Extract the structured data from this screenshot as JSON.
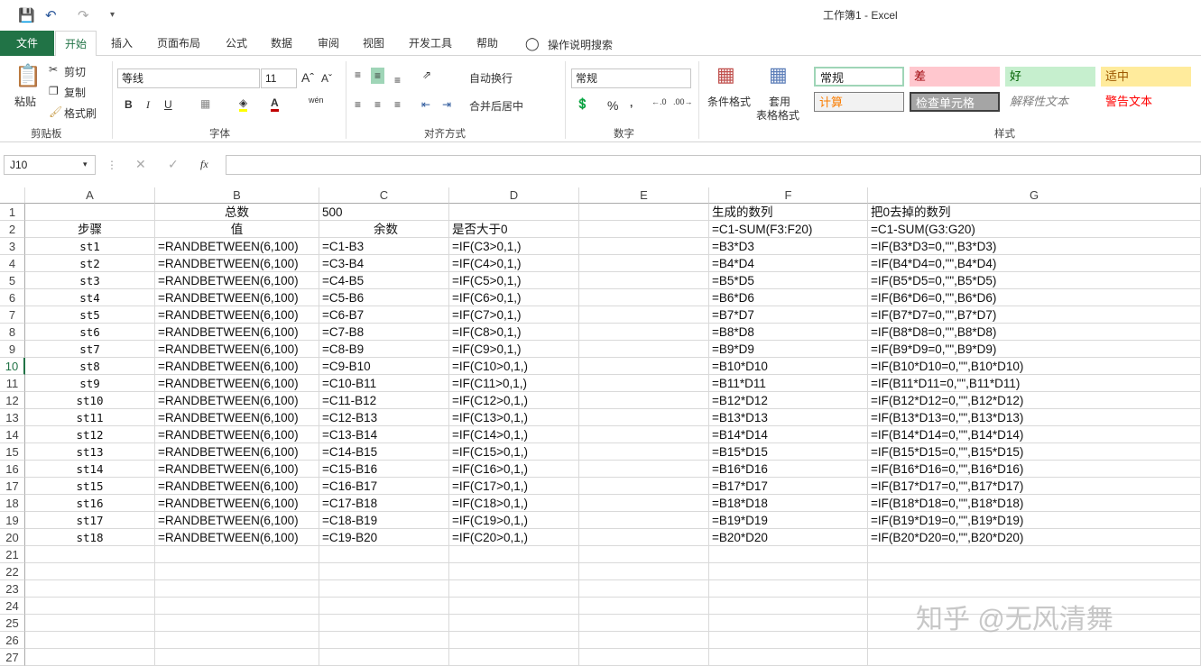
{
  "window": {
    "title": "工作簿1  -  Excel"
  },
  "tabs": [
    "文件",
    "开始",
    "插入",
    "页面布局",
    "公式",
    "数据",
    "审阅",
    "视图",
    "开发工具",
    "帮助"
  ],
  "search_label": "操作说明搜索",
  "clipboard": {
    "paste": "粘贴",
    "cut": "剪切",
    "copy": "复制",
    "format_painter": "格式刷",
    "label": "剪贴板"
  },
  "font": {
    "name": "等线",
    "size": "11",
    "label": "字体",
    "bold": "B",
    "italic": "I",
    "underline": "U",
    "phonetic": "wén"
  },
  "align": {
    "wrap": "自动换行",
    "merge": "合并后居中",
    "label": "对齐方式"
  },
  "number": {
    "format": "常规",
    "percent": "%",
    "comma": ",",
    "label": "数字"
  },
  "styles": {
    "cond": "条件格式",
    "table1": "套用",
    "table2": "表格格式",
    "label": "样式",
    "cells": [
      {
        "t": "常规",
        "bg": "#ffffff",
        "fg": "#222"
      },
      {
        "t": "差",
        "bg": "#ffc7ce",
        "fg": "#9c0006"
      },
      {
        "t": "好",
        "bg": "#c6efce",
        "fg": "#006100"
      },
      {
        "t": "适中",
        "bg": "#ffeb9c",
        "fg": "#9c5700"
      },
      {
        "t": "计算",
        "bg": "#f2f2f2",
        "fg": "#fa7d00"
      },
      {
        "t": "检查单元格",
        "bg": "#a5a5a5",
        "fg": "#ffffff"
      },
      {
        "t": "解释性文本",
        "bg": "#ffffff",
        "fg": "#7f7f7f"
      },
      {
        "t": "警告文本",
        "bg": "#ffffff",
        "fg": "#ff0000"
      }
    ]
  },
  "formula_bar": {
    "name_box": "J10",
    "fx": "fx",
    "value": ""
  },
  "columns": [
    "A",
    "B",
    "C",
    "D",
    "E",
    "F",
    "G"
  ],
  "row_numbers": [
    "1",
    "2",
    "3",
    "4",
    "5",
    "6",
    "7",
    "8",
    "9",
    "10",
    "11",
    "12",
    "13",
    "14",
    "15",
    "16",
    "17",
    "18",
    "19",
    "20",
    "21",
    "22",
    "23",
    "24",
    "25",
    "26",
    "27"
  ],
  "rows": [
    [
      "",
      "总数",
      "500",
      "",
      "",
      "生成的数列",
      "把0去掉的数列"
    ],
    [
      "步骤",
      "值",
      "余数",
      "是否大于0",
      "",
      "=C1-SUM(F3:F20)",
      "=C1-SUM(G3:G20)"
    ],
    [
      "st1",
      "=RANDBETWEEN(6,100)",
      "=C1-B3",
      "=IF(C3>0,1,)",
      "",
      "=B3*D3",
      "=IF(B3*D3=0,\"\",B3*D3)"
    ],
    [
      "st2",
      "=RANDBETWEEN(6,100)",
      "=C3-B4",
      "=IF(C4>0,1,)",
      "",
      "=B4*D4",
      "=IF(B4*D4=0,\"\",B4*D4)"
    ],
    [
      "st3",
      "=RANDBETWEEN(6,100)",
      "=C4-B5",
      "=IF(C5>0,1,)",
      "",
      "=B5*D5",
      "=IF(B5*D5=0,\"\",B5*D5)"
    ],
    [
      "st4",
      "=RANDBETWEEN(6,100)",
      "=C5-B6",
      "=IF(C6>0,1,)",
      "",
      "=B6*D6",
      "=IF(B6*D6=0,\"\",B6*D6)"
    ],
    [
      "st5",
      "=RANDBETWEEN(6,100)",
      "=C6-B7",
      "=IF(C7>0,1,)",
      "",
      "=B7*D7",
      "=IF(B7*D7=0,\"\",B7*D7)"
    ],
    [
      "st6",
      "=RANDBETWEEN(6,100)",
      "=C7-B8",
      "=IF(C8>0,1,)",
      "",
      "=B8*D8",
      "=IF(B8*D8=0,\"\",B8*D8)"
    ],
    [
      "st7",
      "=RANDBETWEEN(6,100)",
      "=C8-B9",
      "=IF(C9>0,1,)",
      "",
      "=B9*D9",
      "=IF(B9*D9=0,\"\",B9*D9)"
    ],
    [
      "st8",
      "=RANDBETWEEN(6,100)",
      "=C9-B10",
      "=IF(C10>0,1,)",
      "",
      "=B10*D10",
      "=IF(B10*D10=0,\"\",B10*D10)"
    ],
    [
      "st9",
      "=RANDBETWEEN(6,100)",
      "=C10-B11",
      "=IF(C11>0,1,)",
      "",
      "=B11*D11",
      "=IF(B11*D11=0,\"\",B11*D11)"
    ],
    [
      "st10",
      "=RANDBETWEEN(6,100)",
      "=C11-B12",
      "=IF(C12>0,1,)",
      "",
      "=B12*D12",
      "=IF(B12*D12=0,\"\",B12*D12)"
    ],
    [
      "st11",
      "=RANDBETWEEN(6,100)",
      "=C12-B13",
      "=IF(C13>0,1,)",
      "",
      "=B13*D13",
      "=IF(B13*D13=0,\"\",B13*D13)"
    ],
    [
      "st12",
      "=RANDBETWEEN(6,100)",
      "=C13-B14",
      "=IF(C14>0,1,)",
      "",
      "=B14*D14",
      "=IF(B14*D14=0,\"\",B14*D14)"
    ],
    [
      "st13",
      "=RANDBETWEEN(6,100)",
      "=C14-B15",
      "=IF(C15>0,1,)",
      "",
      "=B15*D15",
      "=IF(B15*D15=0,\"\",B15*D15)"
    ],
    [
      "st14",
      "=RANDBETWEEN(6,100)",
      "=C15-B16",
      "=IF(C16>0,1,)",
      "",
      "=B16*D16",
      "=IF(B16*D16=0,\"\",B16*D16)"
    ],
    [
      "st15",
      "=RANDBETWEEN(6,100)",
      "=C16-B17",
      "=IF(C17>0,1,)",
      "",
      "=B17*D17",
      "=IF(B17*D17=0,\"\",B17*D17)"
    ],
    [
      "st16",
      "=RANDBETWEEN(6,100)",
      "=C17-B18",
      "=IF(C18>0,1,)",
      "",
      "=B18*D18",
      "=IF(B18*D18=0,\"\",B18*D18)"
    ],
    [
      "st17",
      "=RANDBETWEEN(6,100)",
      "=C18-B19",
      "=IF(C19>0,1,)",
      "",
      "=B19*D19",
      "=IF(B19*D19=0,\"\",B19*D19)"
    ],
    [
      "st18",
      "=RANDBETWEEN(6,100)",
      "=C19-B20",
      "=IF(C20>0,1,)",
      "",
      "=B20*D20",
      "=IF(B20*D20=0,\"\",B20*D20)"
    ]
  ],
  "watermark": "知乎 @无风清舞"
}
